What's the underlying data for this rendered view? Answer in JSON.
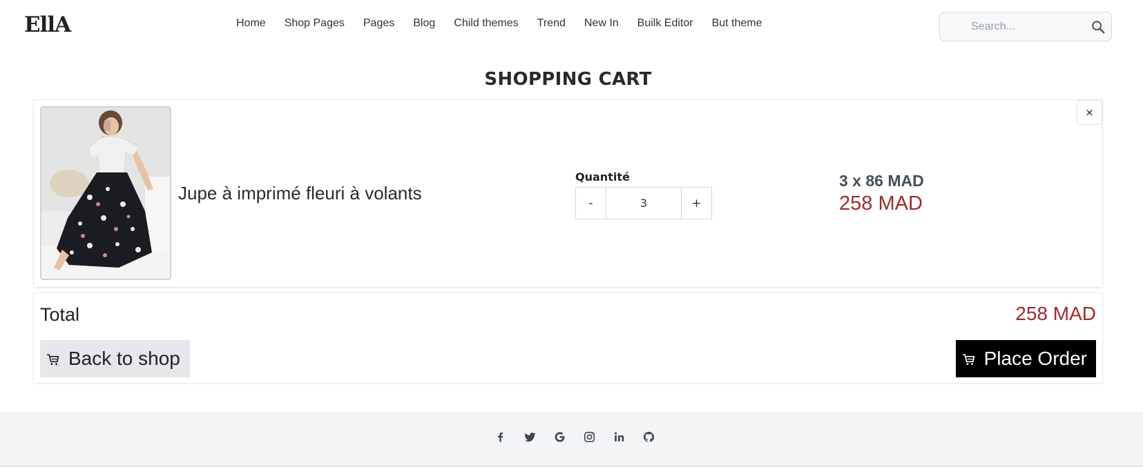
{
  "header": {
    "logo": "EllA",
    "nav": [
      "Home",
      "Shop Pages",
      "Pages",
      "Blog",
      "Child themes",
      "Trend",
      "New In",
      "Builk Editor",
      "But theme"
    ],
    "search_placeholder": "Search..."
  },
  "page_title": "SHOPPING CART",
  "cart": {
    "item": {
      "name": "Jupe à imprimé fleuri à volants",
      "remove_label": "×",
      "quantity_label": "Quantité",
      "quantity": "3",
      "decrement_label": "-",
      "increment_label": "+",
      "unit_price": "3 x 86 MAD",
      "line_total": "258 MAD"
    }
  },
  "totals": {
    "label": "Total",
    "value": "258 MAD",
    "back_label": "Back to shop",
    "order_label": "Place Order"
  },
  "footer": {
    "social_icons": [
      "facebook-icon",
      "twitter-icon",
      "google-icon",
      "instagram-icon",
      "linkedin-icon",
      "github-icon"
    ]
  },
  "colors": {
    "price_red": "#a52828",
    "order_button": "#000000",
    "footer_bg": "#f3f4f6"
  }
}
